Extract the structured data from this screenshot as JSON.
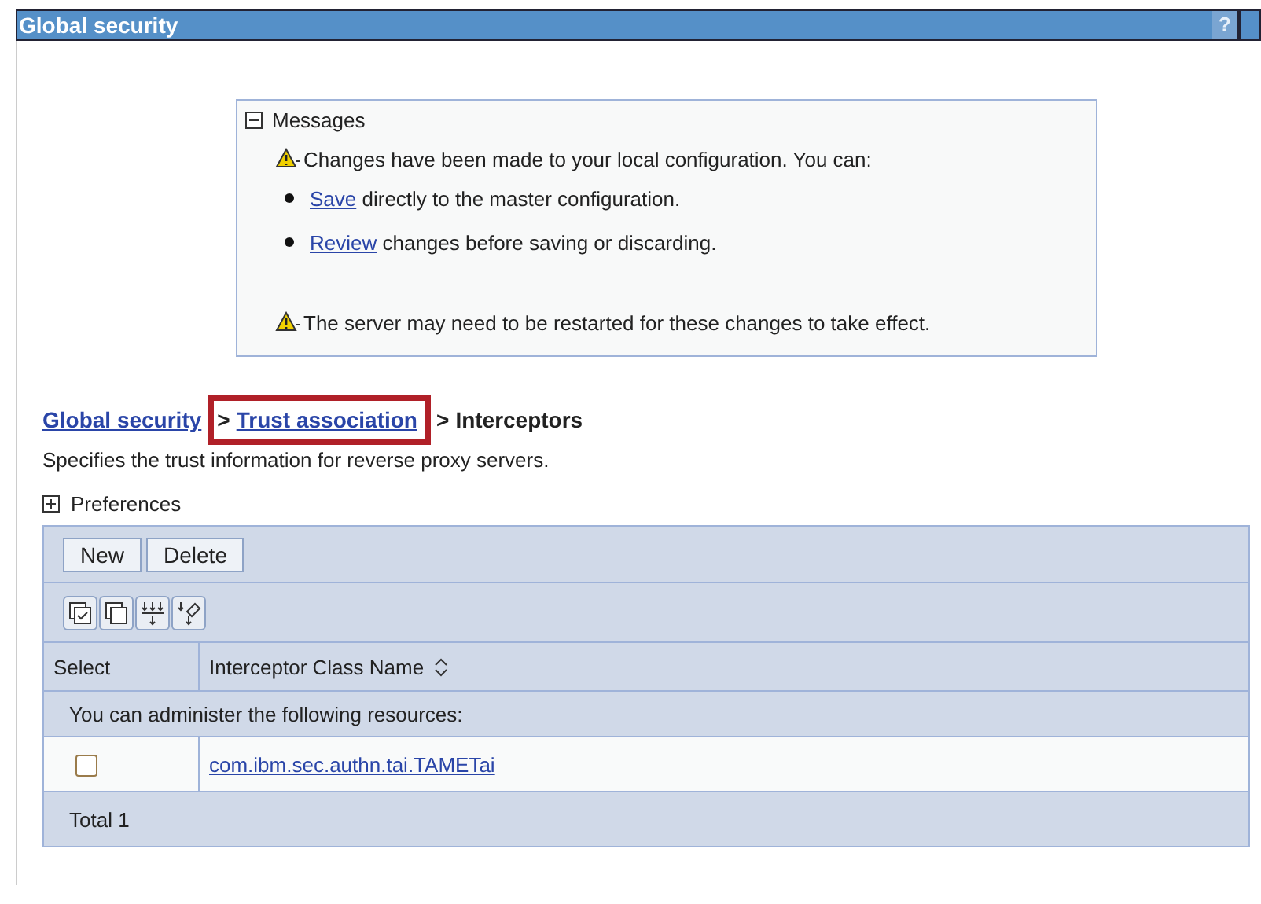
{
  "window": {
    "title": "Global security",
    "help_button": "?"
  },
  "messages": {
    "heading": "Messages",
    "expanded": true,
    "items": [
      {
        "kind": "warning",
        "text": "Changes have been made to your local configuration. You can:"
      },
      {
        "kind": "bullet",
        "link": "Save",
        "text": "directly to the master configuration."
      },
      {
        "kind": "bullet",
        "link": "Review",
        "text": "changes before saving or discarding."
      },
      {
        "kind": "warning",
        "text": "The server may need to be restarted for these changes to take effect."
      }
    ]
  },
  "breadcrumb": [
    {
      "kind": "link",
      "label": "Global security"
    },
    {
      "kind": "link",
      "label": "Trust association",
      "highlighted": true,
      "separator": ">"
    },
    {
      "kind": "current",
      "label": "Interceptors",
      "separator": ">"
    }
  ],
  "description": "Specifies the trust information for reverse proxy servers.",
  "preferences": {
    "label": "Preferences",
    "expanded": false
  },
  "table": {
    "buttons": [
      "New",
      "Delete"
    ],
    "tools": [
      {
        "kind": "select-all"
      },
      {
        "kind": "deselect-all"
      },
      {
        "kind": "filter"
      },
      {
        "kind": "clear-filter"
      }
    ],
    "columns": [
      "Select",
      "Interceptor Class Name"
    ],
    "notice": "You can administer the following resources:",
    "rows": [
      {
        "checked": false,
        "name": "com.ibm.sec.authn.tai.TAMETai"
      }
    ],
    "total": "Total 1"
  }
}
